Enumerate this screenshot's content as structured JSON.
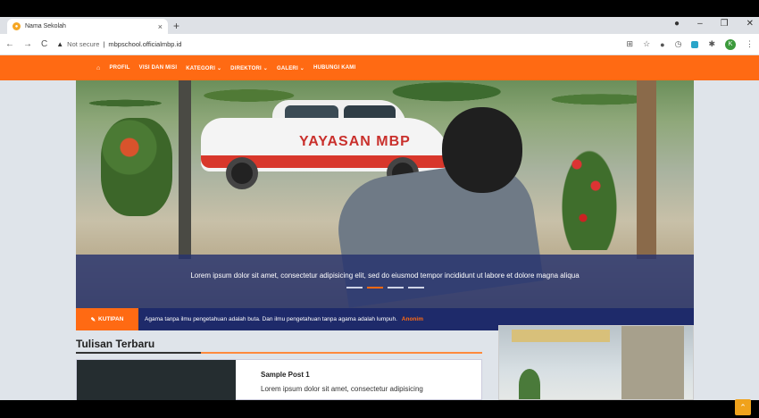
{
  "browser": {
    "tab_title": "Nama Sekolah",
    "tab_close": "×",
    "new_tab": "+",
    "security_label": "Not secure",
    "url": "mbpschool.officialmbp.id",
    "profile_initial": "K"
  },
  "nav": {
    "home_icon": "⌂",
    "items": [
      "PROFIL",
      "VISI DAN MISI",
      "KATEGORI ⌄",
      "DIREKTORI ⌄",
      "GALERI ⌄",
      "HUBUNGI KAMI"
    ]
  },
  "hero": {
    "car_logo": "YAYASAN MBP",
    "caption": "Lorem ipsum dolor sit amet, consectetur adipisicing elit, sed do eiusmod tempor incididunt ut labore et dolore magna aliqua",
    "slides": 4,
    "active_slide": 2
  },
  "quote": {
    "label": "KUTIPAN",
    "text": "Agama tanpa ilmu pengetahuan adalah buta. Dan ilmu pengetahuan tanpa agama adalah lumpuh.",
    "author": "Anonim"
  },
  "latest": {
    "title": "Tulisan Terbaru",
    "post_title": "Sample Post 1",
    "post_excerpt": "Lorem ipsum dolor sit amet, consectetur adipisicing"
  },
  "colors": {
    "accent": "#ff6a13",
    "navy": "#1e2a6a"
  }
}
